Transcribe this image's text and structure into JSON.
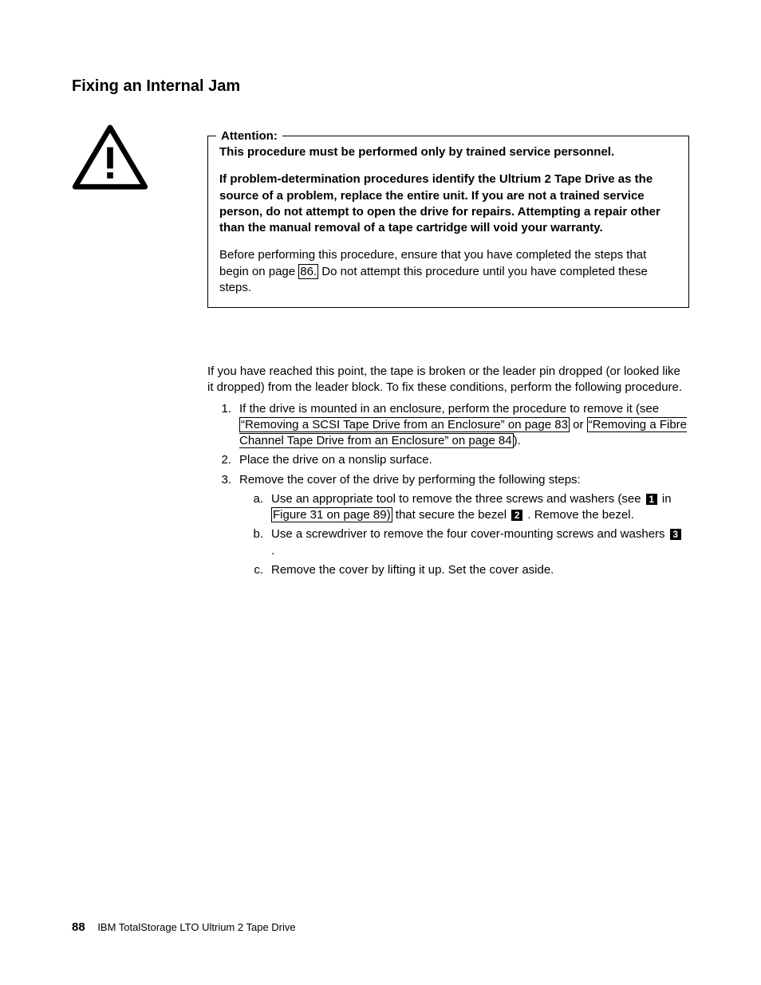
{
  "title": "Fixing an Internal Jam",
  "attention": {
    "legend": "Attention:",
    "p1": "This procedure must be performed only by trained service personnel.",
    "p2": "If problem-determination procedures identify the Ultrium 2 Tape Drive as the source of a problem, replace the entire unit. If you are not a trained service person, do not attempt to open the drive for repairs. Attempting a repair other than the manual removal of a tape cartridge will void your warranty.",
    "p3_a": "Before performing this procedure, ensure that you have completed the steps that begin on page ",
    "p3_page": "86.",
    "p3_b": " Do not attempt this procedure until you have completed these steps."
  },
  "intro": "If you have reached this point, the tape is broken or the leader pin dropped (or looked like it dropped) from the leader block. To fix these conditions, perform the following procedure.",
  "steps": {
    "s1_a": "If the drive is mounted in an enclosure, perform the procedure to remove it (see ",
    "s1_link1": "“Removing a SCSI Tape Drive from an Enclosure” on page 83",
    "s1_mid": " or ",
    "s1_link2": "“Removing a Fibre Channel Tape Drive from an Enclosure” on page 84",
    "s1_end": ").",
    "s2": "Place the drive on a nonslip surface.",
    "s3": "Remove the cover of the drive by performing the following steps:",
    "s3a_a": "Use an appropriate tool to remove the three screws and washers (see ",
    "s3a_b": " in ",
    "s3a_link": "Figure 31 on page 89)",
    "s3a_c": " that secure the bezel ",
    "s3a_d": " . Remove the bezel.",
    "s3b_a": "Use a screwdriver to remove the four cover-mounting screws and washers ",
    "s3b_b": " .",
    "s3c": "Remove the cover by lifting it up. Set the cover aside."
  },
  "callouts": {
    "c1": "1",
    "c2": "2",
    "c3": "3"
  },
  "markers": {
    "n1": "1.",
    "n2": "2.",
    "n3": "3.",
    "a": "a.",
    "b": "b.",
    "c": "c."
  },
  "footer": {
    "pagenum": "88",
    "doc": "IBM TotalStorage LTO Ultrium 2 Tape Drive"
  }
}
